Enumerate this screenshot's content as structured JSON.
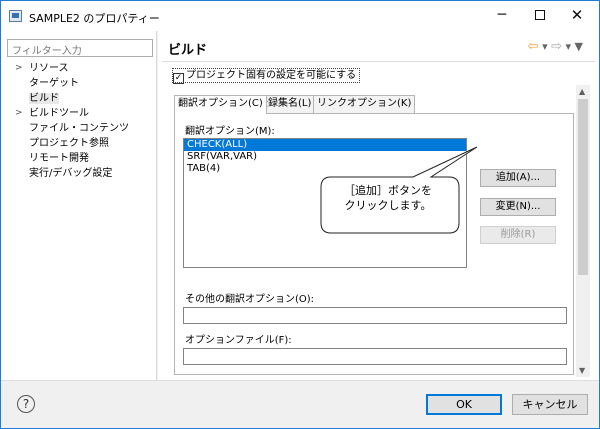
{
  "window": {
    "title": "SAMPLE2 のプロパティー",
    "minimize": "─",
    "close": "✕"
  },
  "sidebar": {
    "filter_placeholder": "フィルター入力",
    "items": [
      {
        "label": "リソース",
        "expandable": true
      },
      {
        "label": "ターゲット",
        "expandable": false
      },
      {
        "label": "ビルド",
        "expandable": false,
        "selected": true
      },
      {
        "label": "ビルドツール",
        "expandable": true
      },
      {
        "label": "ファイル・コンテンツ",
        "expandable": false
      },
      {
        "label": "プロジェクト参照",
        "expandable": false
      },
      {
        "label": "リモート開発",
        "expandable": false
      },
      {
        "label": "実行/デバッグ設定",
        "expandable": false
      }
    ]
  },
  "page": {
    "title": "ビルド",
    "enable_project_settings": "プロジェクト固有の設定を可能にする",
    "enable_checked": true
  },
  "tabs": [
    {
      "label": "翻訳オプション(C)",
      "active": true
    },
    {
      "label": "登録集名(L)",
      "active": false
    },
    {
      "label": "リンクオプション(K)",
      "active": false
    }
  ],
  "translation": {
    "label": "翻訳オプション(M):",
    "options": [
      "CHECK(ALL)",
      "SRF(VAR,VAR)",
      "TAB(4)"
    ],
    "selected_index": 0,
    "buttons": {
      "add": "追加(A)...",
      "change": "変更(N)...",
      "delete": "削除(R)"
    },
    "other_label": "その他の翻訳オプション(O):",
    "other_value": "",
    "file_label": "オプションファイル(F):",
    "file_value": ""
  },
  "callout": {
    "line1": "［追加］ボタンを",
    "line2": "クリックします。"
  },
  "footer": {
    "help": "?",
    "ok": "OK",
    "cancel": "キャンセル"
  }
}
